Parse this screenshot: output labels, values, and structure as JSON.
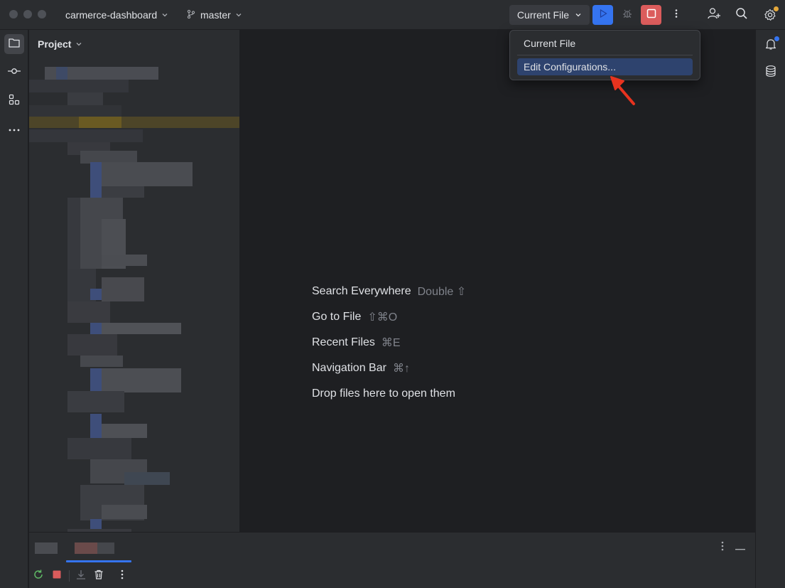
{
  "titlebar": {
    "project_name": "carmerce-dashboard",
    "branch_name": "master",
    "run_config_label": "Current File"
  },
  "project_panel": {
    "title": "Project"
  },
  "run_dropdown": {
    "items": [
      {
        "label": "Current File"
      },
      {
        "label": "Edit Configurations..."
      }
    ]
  },
  "editor": {
    "hints": [
      {
        "action": "Search Everywhere",
        "shortcut": "Double ⇧"
      },
      {
        "action": "Go to File",
        "shortcut": "⇧⌘O"
      },
      {
        "action": "Recent Files",
        "shortcut": "⌘E"
      },
      {
        "action": "Navigation Bar",
        "shortcut": "⌘↑"
      },
      {
        "action": "Drop files here to open them",
        "shortcut": ""
      }
    ]
  },
  "colors": {
    "accent_blue": "#3574f0",
    "stop_red": "#db5c5c",
    "selection": "#2e436e",
    "annotation_arrow": "#e8331f",
    "notification_dot": "#3574f0",
    "settings_dot": "#e5a83b"
  },
  "icons": {
    "project_folder": "folder-icon",
    "commit": "commit-icon",
    "structure": "structure-icon",
    "more_tools": "more-horizontal-icon",
    "notifications": "bell-icon",
    "database": "database-icon",
    "add_user": "add-user-icon",
    "search": "search-icon",
    "settings": "gear-icon"
  }
}
